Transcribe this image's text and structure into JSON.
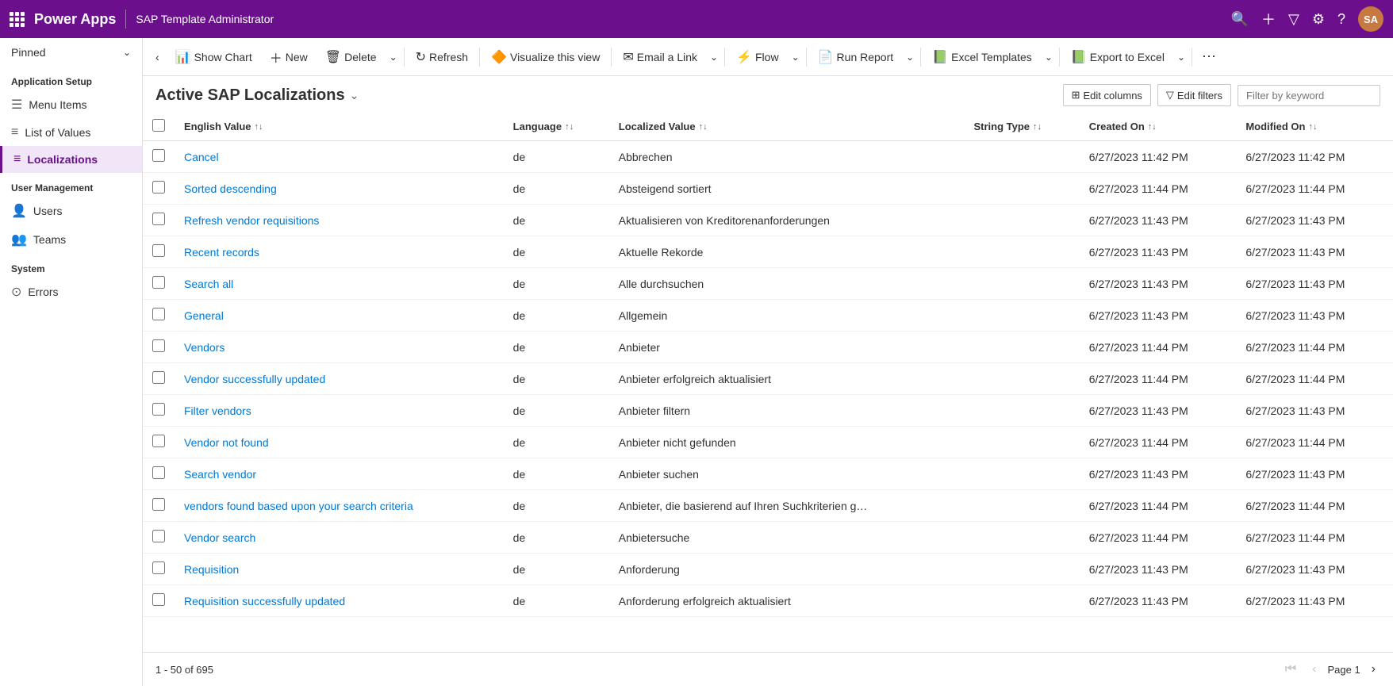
{
  "app": {
    "name": "Power Apps",
    "title": "SAP Template Administrator"
  },
  "topbar": {
    "icons": [
      "search",
      "plus",
      "filter",
      "settings",
      "help"
    ],
    "avatar_initials": "SA"
  },
  "sidebar": {
    "pinned_label": "Pinned",
    "sections": [
      {
        "label": "Application Setup",
        "items": [
          {
            "id": "menu-items",
            "label": "Menu Items",
            "icon": "☰",
            "active": false
          },
          {
            "id": "list-of-values",
            "label": "List of Values",
            "icon": "≡",
            "active": false
          },
          {
            "id": "localizations",
            "label": "Localizations",
            "icon": "≡",
            "active": true
          }
        ]
      },
      {
        "label": "User Management",
        "items": [
          {
            "id": "users",
            "label": "Users",
            "icon": "👤",
            "active": false
          },
          {
            "id": "teams",
            "label": "Teams",
            "icon": "👥",
            "active": false
          }
        ]
      },
      {
        "label": "System",
        "items": [
          {
            "id": "errors",
            "label": "Errors",
            "icon": "⊙",
            "active": false
          }
        ]
      }
    ]
  },
  "commandbar": {
    "back_label": "‹",
    "show_chart_label": "Show Chart",
    "new_label": "New",
    "delete_label": "Delete",
    "refresh_label": "Refresh",
    "visualize_label": "Visualize this view",
    "email_link_label": "Email a Link",
    "flow_label": "Flow",
    "run_report_label": "Run Report",
    "excel_templates_label": "Excel Templates",
    "export_excel_label": "Export to Excel"
  },
  "page": {
    "title": "Active SAP Localizations",
    "edit_columns_label": "Edit columns",
    "edit_filters_label": "Edit filters",
    "filter_placeholder": "Filter by keyword"
  },
  "table": {
    "columns": [
      {
        "id": "english_value",
        "label": "English Value",
        "sortable": true,
        "sort": "asc"
      },
      {
        "id": "language",
        "label": "Language",
        "sortable": true,
        "sort": "asc"
      },
      {
        "id": "localized_value",
        "label": "Localized Value",
        "sortable": true,
        "sort": "asc"
      },
      {
        "id": "string_type",
        "label": "String Type",
        "sortable": true,
        "sort": "none"
      },
      {
        "id": "created_on",
        "label": "Created On",
        "sortable": true,
        "sort": "desc"
      },
      {
        "id": "modified_on",
        "label": "Modified On",
        "sortable": true,
        "sort": "desc"
      }
    ],
    "rows": [
      {
        "english_value": "Cancel",
        "language": "de",
        "localized_value": "Abbrechen",
        "string_type": "",
        "created_on": "6/27/2023 11:42 PM",
        "modified_on": "6/27/2023 11:42 PM"
      },
      {
        "english_value": "Sorted descending",
        "language": "de",
        "localized_value": "Absteigend sortiert",
        "string_type": "",
        "created_on": "6/27/2023 11:44 PM",
        "modified_on": "6/27/2023 11:44 PM"
      },
      {
        "english_value": "Refresh vendor requisitions",
        "language": "de",
        "localized_value": "Aktualisieren von Kreditorenanforderungen",
        "string_type": "",
        "created_on": "6/27/2023 11:43 PM",
        "modified_on": "6/27/2023 11:43 PM"
      },
      {
        "english_value": "Recent records",
        "language": "de",
        "localized_value": "Aktuelle Rekorde",
        "string_type": "",
        "created_on": "6/27/2023 11:43 PM",
        "modified_on": "6/27/2023 11:43 PM"
      },
      {
        "english_value": "Search all",
        "language": "de",
        "localized_value": "Alle durchsuchen",
        "string_type": "",
        "created_on": "6/27/2023 11:43 PM",
        "modified_on": "6/27/2023 11:43 PM"
      },
      {
        "english_value": "General",
        "language": "de",
        "localized_value": "Allgemein",
        "string_type": "",
        "created_on": "6/27/2023 11:43 PM",
        "modified_on": "6/27/2023 11:43 PM"
      },
      {
        "english_value": "Vendors",
        "language": "de",
        "localized_value": "Anbieter",
        "string_type": "",
        "created_on": "6/27/2023 11:44 PM",
        "modified_on": "6/27/2023 11:44 PM"
      },
      {
        "english_value": "Vendor successfully updated",
        "language": "de",
        "localized_value": "Anbieter erfolgreich aktualisiert",
        "string_type": "",
        "created_on": "6/27/2023 11:44 PM",
        "modified_on": "6/27/2023 11:44 PM"
      },
      {
        "english_value": "Filter vendors",
        "language": "de",
        "localized_value": "Anbieter filtern",
        "string_type": "",
        "created_on": "6/27/2023 11:43 PM",
        "modified_on": "6/27/2023 11:43 PM"
      },
      {
        "english_value": "Vendor not found",
        "language": "de",
        "localized_value": "Anbieter nicht gefunden",
        "string_type": "",
        "created_on": "6/27/2023 11:44 PM",
        "modified_on": "6/27/2023 11:44 PM"
      },
      {
        "english_value": "Search vendor",
        "language": "de",
        "localized_value": "Anbieter suchen",
        "string_type": "",
        "created_on": "6/27/2023 11:43 PM",
        "modified_on": "6/27/2023 11:43 PM"
      },
      {
        "english_value": "vendors found based upon your search criteria",
        "language": "de",
        "localized_value": "Anbieter, die basierend auf Ihren Suchkriterien g…",
        "string_type": "",
        "created_on": "6/27/2023 11:44 PM",
        "modified_on": "6/27/2023 11:44 PM"
      },
      {
        "english_value": "Vendor search",
        "language": "de",
        "localized_value": "Anbietersuche",
        "string_type": "",
        "created_on": "6/27/2023 11:44 PM",
        "modified_on": "6/27/2023 11:44 PM"
      },
      {
        "english_value": "Requisition",
        "language": "de",
        "localized_value": "Anforderung",
        "string_type": "",
        "created_on": "6/27/2023 11:43 PM",
        "modified_on": "6/27/2023 11:43 PM"
      },
      {
        "english_value": "Requisition successfully updated",
        "language": "de",
        "localized_value": "Anforderung erfolgreich aktualisiert",
        "string_type": "",
        "created_on": "6/27/2023 11:43 PM",
        "modified_on": "6/27/2023 11:43 PM"
      }
    ]
  },
  "footer": {
    "range_label": "1 - 50 of 695",
    "page_label": "Page 1"
  }
}
